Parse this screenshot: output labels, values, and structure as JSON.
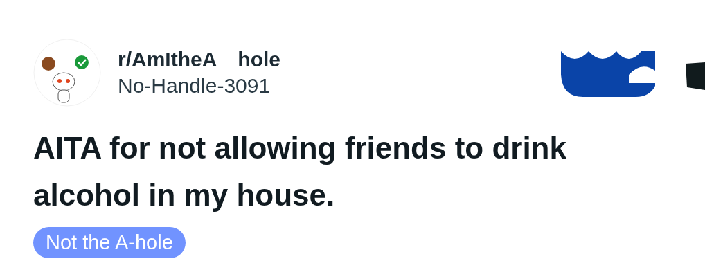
{
  "post": {
    "subreddit": [
      "r/AmItheA",
      "hole"
    ],
    "author": "No-Handle-3091",
    "title": "AITA for not allowing friends to drink alcohol in my house.",
    "flair": {
      "label": "Not the A-hole",
      "color": "#7193ff"
    }
  }
}
